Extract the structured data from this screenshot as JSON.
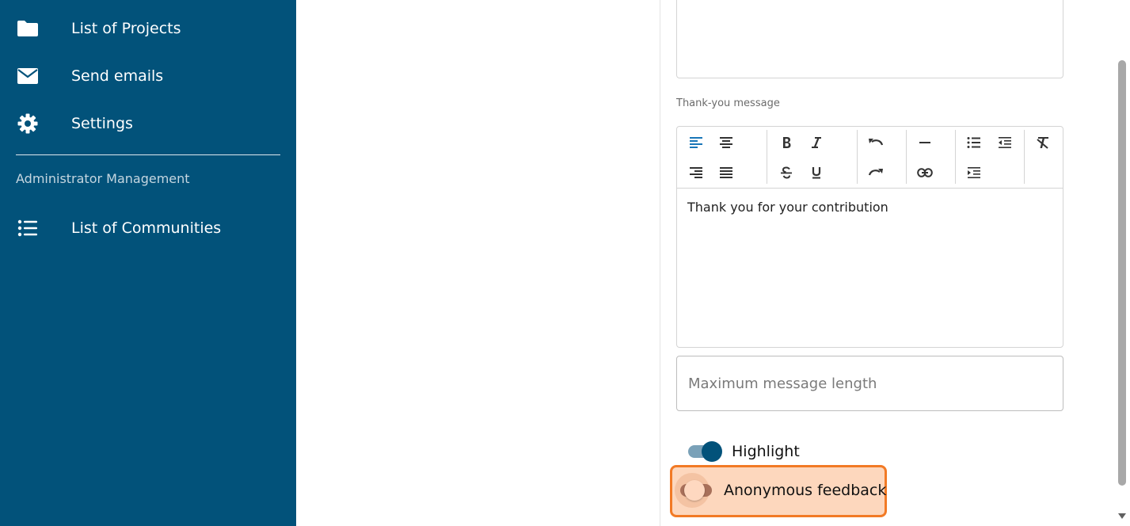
{
  "sidebar": {
    "items": [
      {
        "label": "List of Projects",
        "icon": "folder-icon"
      },
      {
        "label": "Send emails",
        "icon": "envelope-icon"
      },
      {
        "label": "Settings",
        "icon": "gear-icon"
      }
    ],
    "section_title": "Administrator Management",
    "admin_items": [
      {
        "label": "List of Communities",
        "icon": "list-icon"
      }
    ],
    "background_color": "#02527a"
  },
  "form": {
    "thank_you_label": "Thank-you message",
    "editor_content": "Thank you for your contribution",
    "toolbar": [
      "align-left-icon",
      "align-center-icon",
      "align-right-icon",
      "align-justify-icon",
      "bold-icon",
      "italic-icon",
      "strikethrough-icon",
      "underline-icon",
      "undo-icon",
      "redo-icon",
      "horizontal-rule-icon",
      "link-icon",
      "bullet-list-icon",
      "outdent-icon",
      "indent-icon",
      "clear-format-icon"
    ],
    "max_length_placeholder": "Maximum message length",
    "max_length_value": "",
    "highlight_label": "Highlight",
    "highlight_on": true,
    "anonymous_label": "Anonymous feedback",
    "anonymous_on": false,
    "accent_color": "#02527a",
    "highlight_box_color": "#f27a25"
  }
}
